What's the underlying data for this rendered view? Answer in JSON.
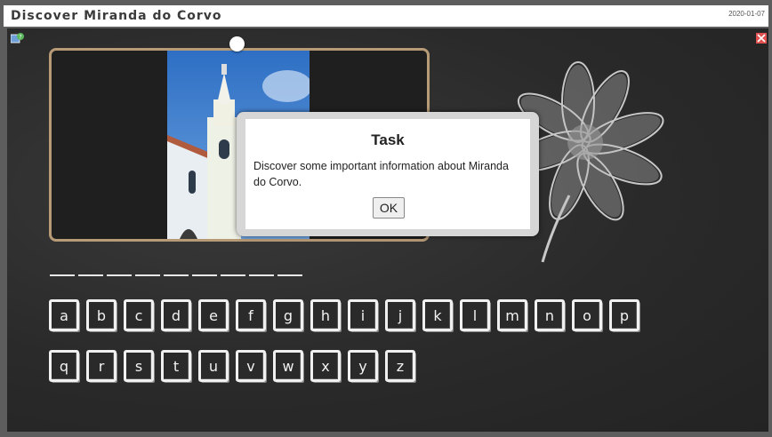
{
  "header": {
    "title": "Discover Miranda do Corvo",
    "date": "2020-01-07"
  },
  "icons": {
    "help": "help-icon",
    "close": "close-icon",
    "pin": "pin-icon",
    "flower": "chalk-flower-icon"
  },
  "word_blanks": 9,
  "keyboard": {
    "row1": [
      "a",
      "b",
      "c",
      "d",
      "e",
      "f",
      "g",
      "h",
      "i",
      "j",
      "k",
      "l",
      "m",
      "n",
      "o",
      "p"
    ],
    "row2": [
      "q",
      "r",
      "s",
      "t",
      "u",
      "v",
      "w",
      "x",
      "y",
      "z"
    ]
  },
  "dialog": {
    "title": "Task",
    "message": "Discover some important information about Miranda do Corvo.",
    "ok_label": "OK"
  },
  "colors": {
    "board": "#2b2b2b",
    "frame_border": "#b79b77",
    "chalk": "#f0f0f0"
  }
}
